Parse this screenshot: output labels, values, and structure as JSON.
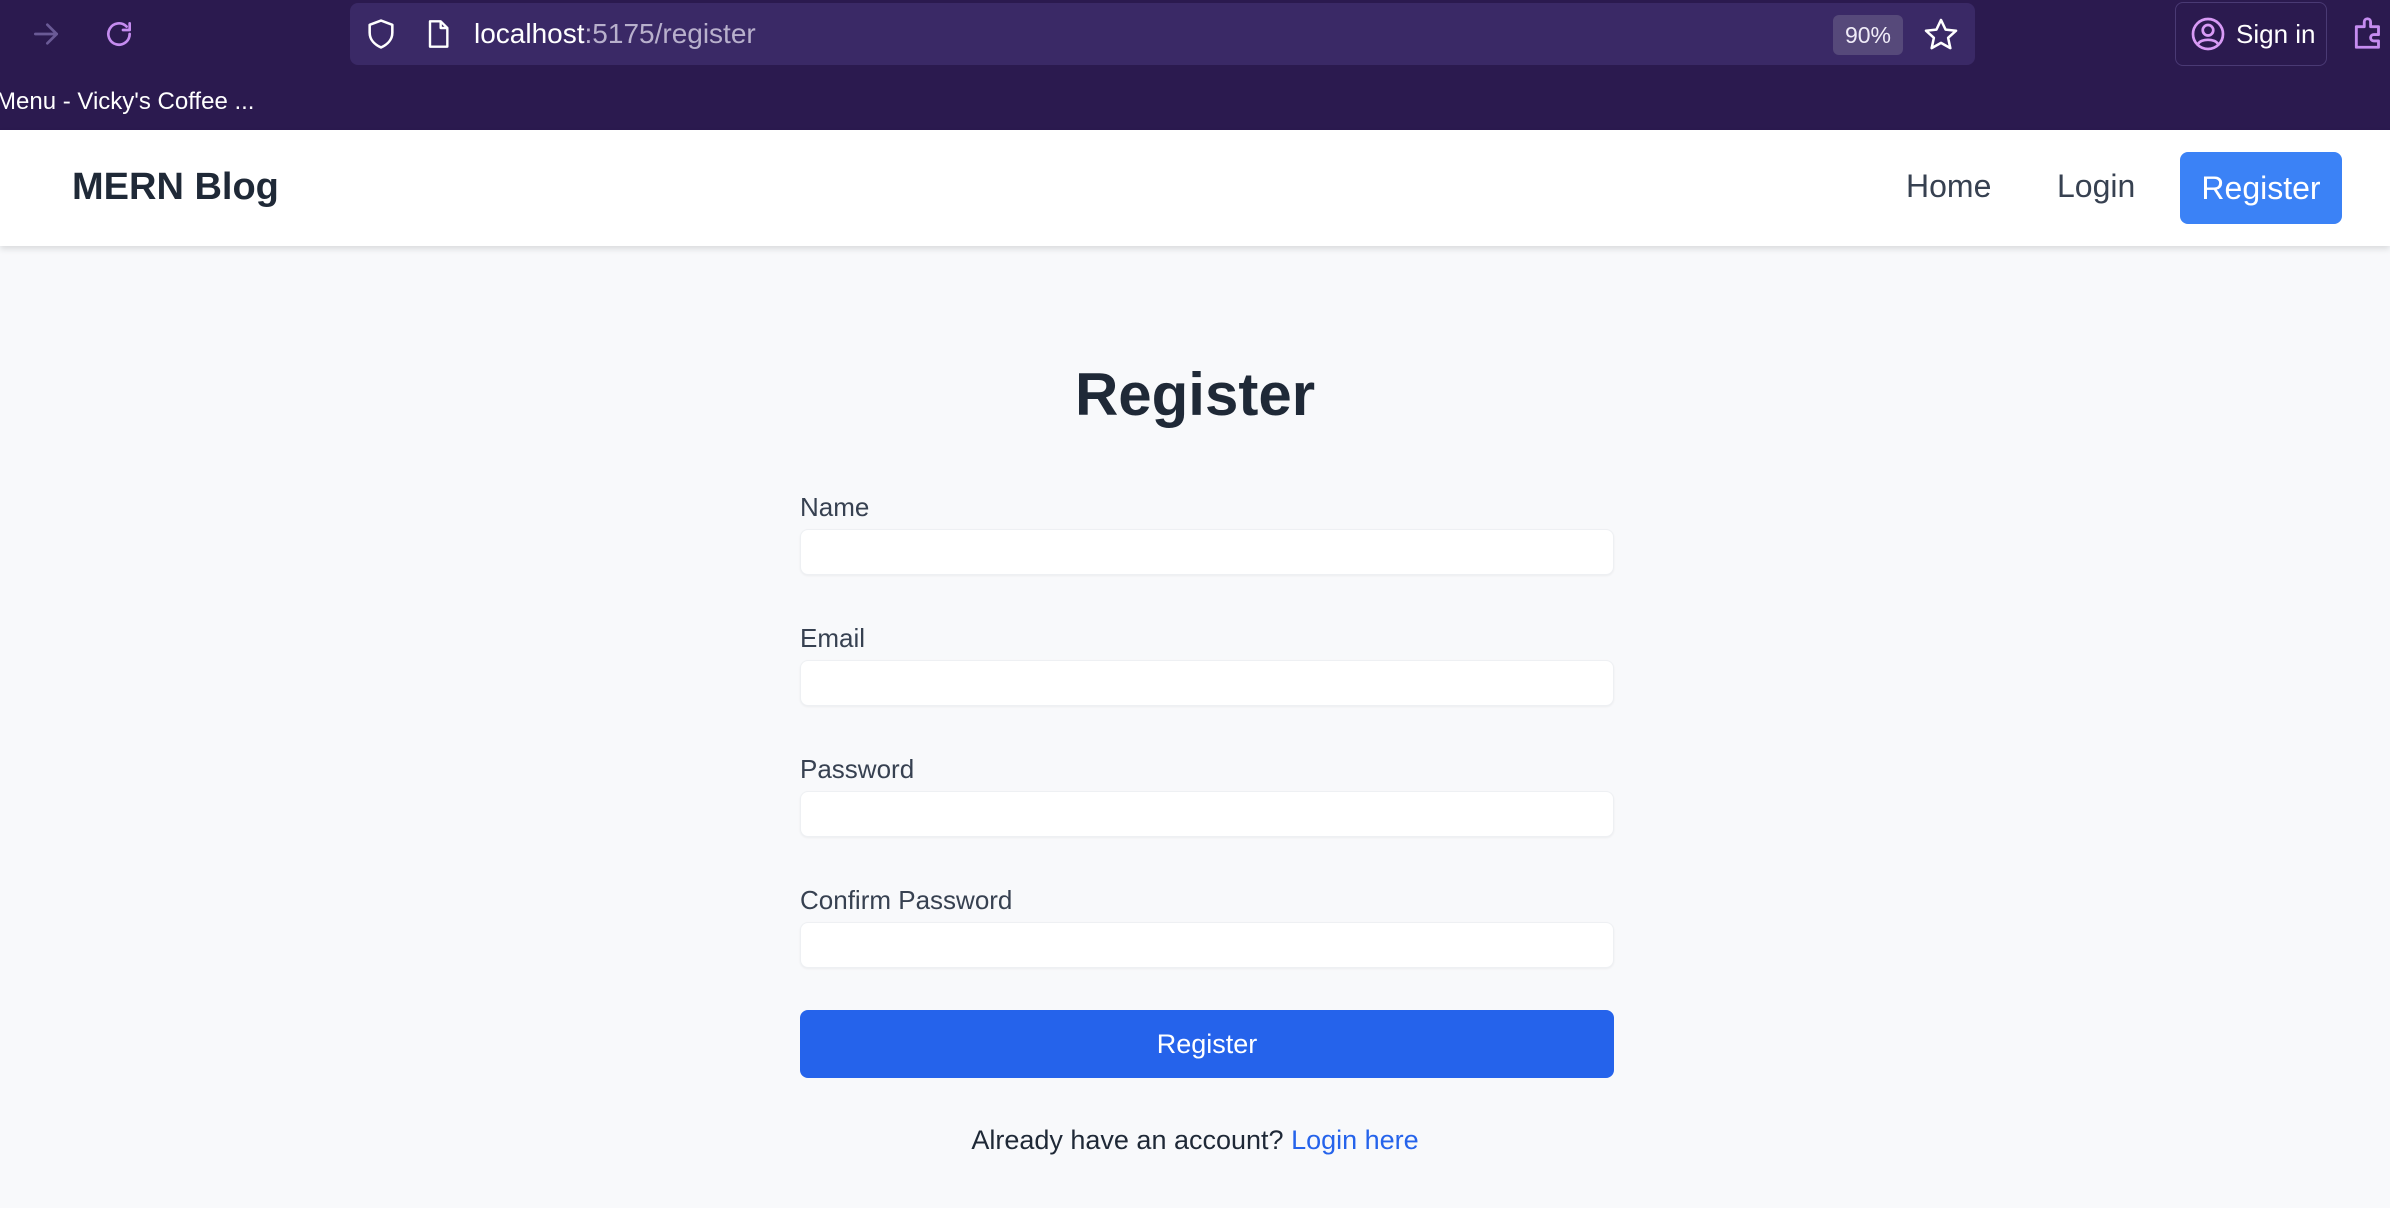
{
  "browser": {
    "url_host": "localhost",
    "url_path": ":5175/register",
    "zoom": "90%",
    "sign_in_label": "Sign in",
    "bookmark_label": "Menu - Vicky's Coffee ..."
  },
  "header": {
    "brand": "MERN Blog",
    "nav": {
      "home": "Home",
      "login": "Login",
      "register": "Register"
    }
  },
  "form": {
    "title": "Register",
    "fields": [
      {
        "label": "Name",
        "value": ""
      },
      {
        "label": "Email",
        "value": ""
      },
      {
        "label": "Password",
        "value": ""
      },
      {
        "label": "Confirm Password",
        "value": ""
      }
    ],
    "submit_label": "Register",
    "footer_text": "Already have an account?",
    "footer_link": "Login here"
  },
  "colors": {
    "chrome_bg": "#2b1a4f",
    "accent": "#3b82f6",
    "submit": "#2563eb"
  },
  "icons": [
    "forward-icon",
    "reload-icon",
    "shield-icon",
    "page-icon",
    "star-icon",
    "account-icon",
    "extensions-icon"
  ]
}
